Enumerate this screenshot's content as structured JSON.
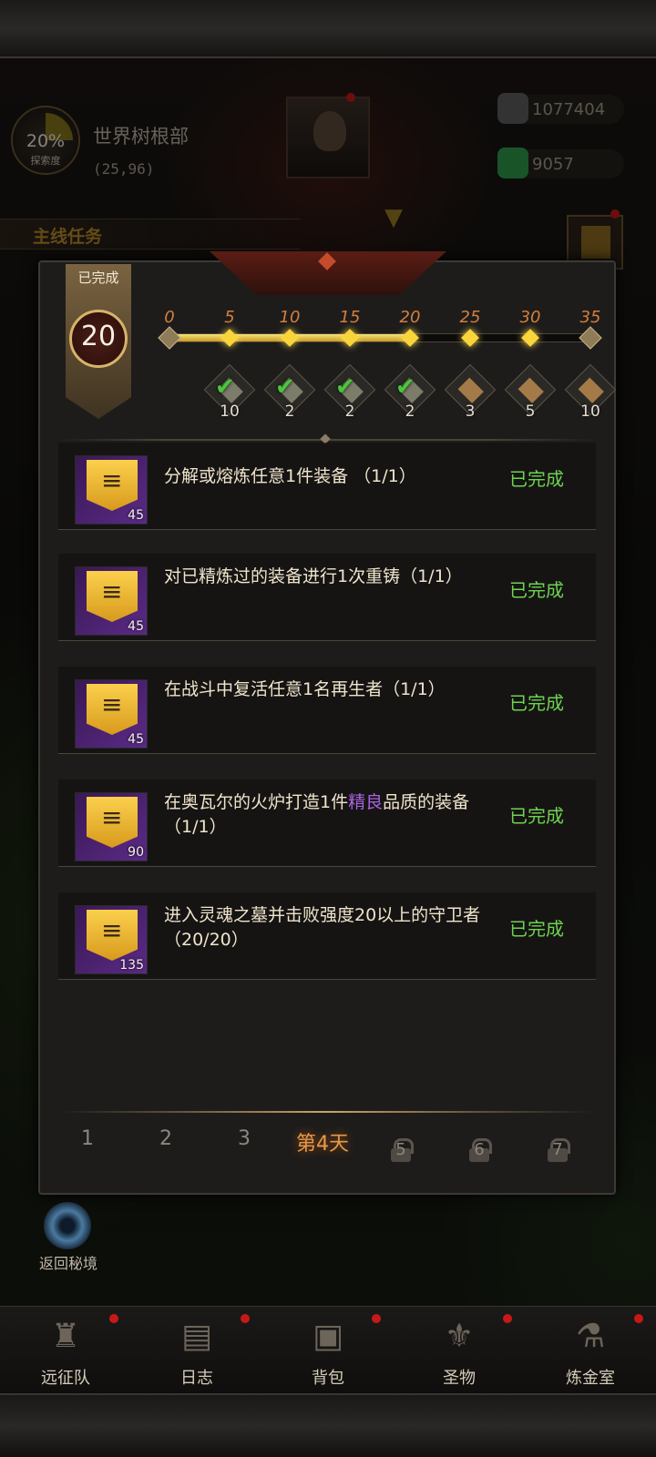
{
  "hud": {
    "explore_percent": "20%",
    "explore_label": "探索度",
    "location_name": "世界树根部",
    "location_coords": "(25,96)",
    "currencies": [
      {
        "icon": "ore-icon",
        "value": "1077404",
        "color": "#6f6f6f"
      },
      {
        "icon": "emerald-icon",
        "value": "9057",
        "color": "#2f9a4c"
      }
    ],
    "quest_tag": "主线任务",
    "return_label": "返回秘境"
  },
  "panel": {
    "banner_label": "已完成",
    "completed_count": "20",
    "progress": {
      "value": 20,
      "max": 35,
      "ticks": [
        "0",
        "5",
        "10",
        "15",
        "20",
        "25",
        "30",
        "35"
      ],
      "rewards": [
        {
          "qty": "10",
          "claimed": true,
          "icon": "scroll-icon"
        },
        {
          "qty": "2",
          "claimed": true,
          "icon": "scroll-icon"
        },
        {
          "qty": "2",
          "claimed": true,
          "icon": "scroll-icon"
        },
        {
          "qty": "2",
          "claimed": true,
          "icon": "scroll-icon"
        },
        {
          "qty": "3",
          "claimed": false,
          "icon": "scroll-icon"
        },
        {
          "qty": "5",
          "claimed": false,
          "icon": "scroll-icon"
        },
        {
          "qty": "10",
          "claimed": false,
          "icon": "scroll-icon"
        }
      ]
    },
    "tasks": [
      {
        "text": "分解或熔炼任意1件装备 （1/1）",
        "reward": "45",
        "status": "已完成"
      },
      {
        "text": "对已精炼过的装备进行1次重铸（1/1）",
        "reward": "45",
        "status": "已完成"
      },
      {
        "text": "在战斗中复活任意1名再生者（1/1）",
        "reward": "45",
        "status": "已完成"
      },
      {
        "text_before": "在奥瓦尔的火炉打造1件",
        "text_highlight": "精良",
        "text_after": "品质的装备 （1/1）",
        "reward": "90",
        "status": "已完成"
      },
      {
        "text": "进入灵魂之墓并击败强度20以上的守卫者 （20/20）",
        "reward": "135",
        "status": "已完成"
      }
    ],
    "day_tabs": [
      {
        "label": "1",
        "state": "normal"
      },
      {
        "label": "2",
        "state": "normal"
      },
      {
        "label": "3",
        "state": "normal"
      },
      {
        "label": "第4天",
        "state": "active"
      },
      {
        "label": "5",
        "state": "locked"
      },
      {
        "label": "6",
        "state": "locked"
      },
      {
        "label": "7",
        "state": "locked"
      }
    ]
  },
  "nav": [
    {
      "label": "远征队",
      "icon": "helmet-icon",
      "badge": true
    },
    {
      "label": "日志",
      "icon": "journal-icon",
      "badge": true
    },
    {
      "label": "背包",
      "icon": "backpack-icon",
      "badge": true
    },
    {
      "label": "圣物",
      "icon": "relic-icon",
      "badge": true
    },
    {
      "label": "炼金室",
      "icon": "alchemy-icon",
      "badge": true
    }
  ]
}
